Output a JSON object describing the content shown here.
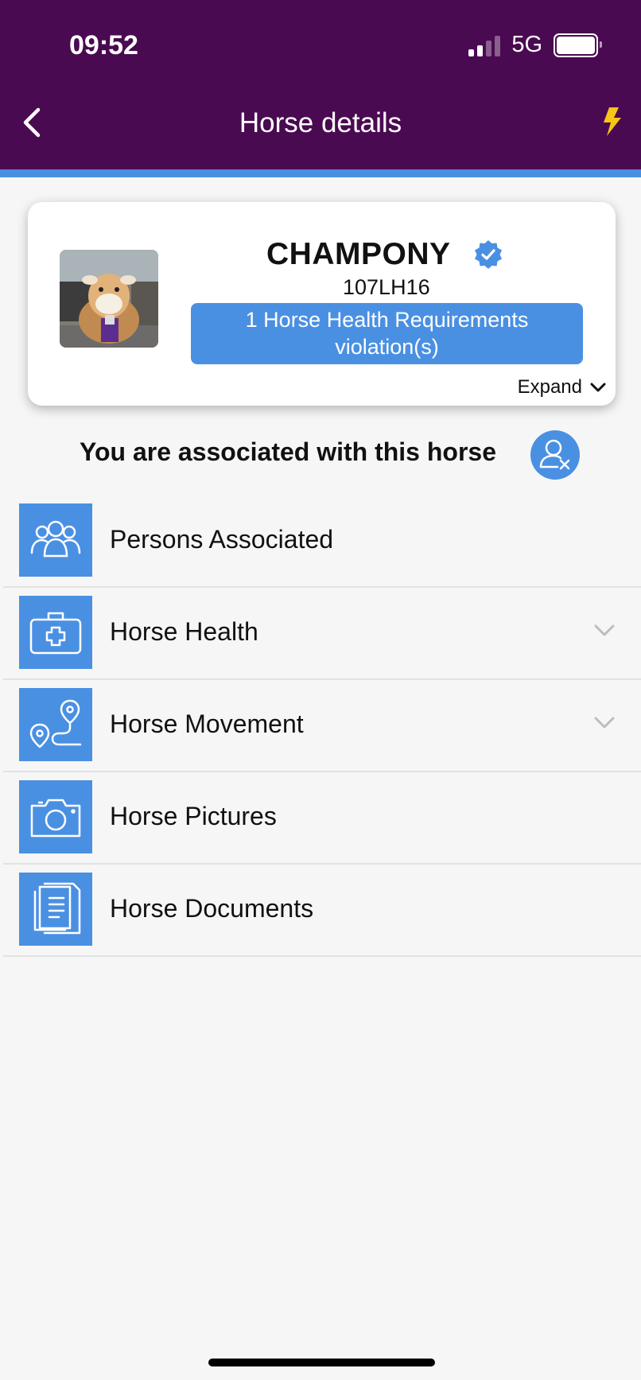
{
  "status_bar": {
    "time": "09:52",
    "network": "5G",
    "signal_icon": "cellular-signal-icon",
    "battery_icon": "battery-icon"
  },
  "header": {
    "title": "Horse details",
    "back_icon": "chevron-left-icon",
    "action_icon": "lightning-icon"
  },
  "horse_card": {
    "name": "CHAMPONY",
    "id": "107LH16",
    "verified_icon": "verified-badge-icon",
    "violation_line1": "1 Horse Health Requirements",
    "violation_line2": "violation(s)",
    "expand_label": "Expand"
  },
  "association": {
    "text": "You are associated with this horse",
    "action_icon": "remove-user-icon"
  },
  "menu": [
    {
      "label": "Persons Associated",
      "icon": "group-people-icon",
      "expandable": false
    },
    {
      "label": "Horse Health",
      "icon": "medical-kit-icon",
      "expandable": true
    },
    {
      "label": "Horse Movement",
      "icon": "route-pins-icon",
      "expandable": true
    },
    {
      "label": "Horse Pictures",
      "icon": "camera-icon",
      "expandable": false
    },
    {
      "label": "Horse Documents",
      "icon": "documents-icon",
      "expandable": false
    }
  ],
  "colors": {
    "header_bg": "#4a0a51",
    "accent": "#4a90e2",
    "flash": "#f5c518",
    "page_bg": "#f6f6f6"
  }
}
